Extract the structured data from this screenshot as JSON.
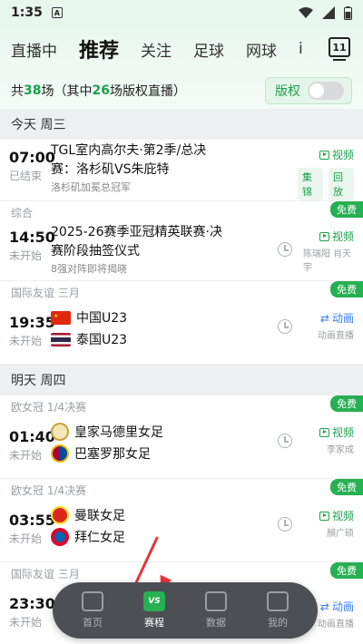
{
  "status": {
    "time": "1:35",
    "badge": "A"
  },
  "tabs": [
    "直播中",
    "推荐",
    "关注",
    "足球",
    "网球",
    "i"
  ],
  "tab_menu_label": "11",
  "summary": {
    "prefix": "共",
    "total": "38",
    "mid": "场（其中",
    "copyright_count": "26",
    "suffix": "场版权直播）"
  },
  "copyright_toggle": {
    "label": "版权",
    "on": false
  },
  "sections": [
    {
      "date": "今天 周三",
      "matches": [
        {
          "competition": "",
          "time": "07:00",
          "status": "已结束",
          "title_line1": "TGL室内高尔夫·第2季/总决",
          "title_line2": "赛：洛杉矶VS朱庇特",
          "subtitle": "洛杉矶加冕总冠军",
          "actions": [
            "视频"
          ],
          "buttons": [
            "集锦",
            "回放"
          ],
          "free": ""
        },
        {
          "competition": "综合",
          "time": "14:50",
          "status": "未开始",
          "title_line1": "2025-26赛季亚冠精英联赛·决",
          "title_line2": "赛阶段抽签仪式",
          "subtitle": "8强对阵即将揭晓",
          "actions": [
            "视频"
          ],
          "commentator": "陈瑞阳 肖天宇",
          "free": "免费"
        },
        {
          "competition": "国际友谊 三月",
          "time": "19:35",
          "status": "未开始",
          "home": "中国U23",
          "away": "泰国U23",
          "actions": [
            "动画"
          ],
          "commentator": "动画直播",
          "free": "免费"
        }
      ]
    },
    {
      "date": "明天 周四",
      "matches": [
        {
          "competition": "欧女冠 1/4决赛",
          "time": "01:40",
          "status": "未开始",
          "home": "皇家马德里女足",
          "away": "巴塞罗那女足",
          "actions": [
            "视频"
          ],
          "commentator": "李家成",
          "free": "免费"
        },
        {
          "competition": "欧女冠 1/4决赛",
          "time": "03:55",
          "status": "未开始",
          "home": "曼联女足",
          "away": "拜仁女足",
          "actions": [
            "视频"
          ],
          "commentator": "顏广硕",
          "free": "免费"
        },
        {
          "competition": "国际友谊 三月",
          "time": "23:30",
          "status": "未开始",
          "actions": [
            "动画"
          ],
          "commentator": "动画直播",
          "free": "免费"
        }
      ]
    }
  ],
  "bottom_nav": [
    {
      "label": "首页",
      "icon": "pitch-icon"
    },
    {
      "label": "赛程",
      "icon": "vs-icon",
      "text": "VS",
      "active": true
    },
    {
      "label": "数据",
      "icon": "chart-icon"
    },
    {
      "label": "我的",
      "icon": "jersey-icon"
    }
  ],
  "colors": {
    "accent": "#26b052",
    "link_blue": "#3c7df0",
    "annotation_arrow": "#e8363a"
  }
}
